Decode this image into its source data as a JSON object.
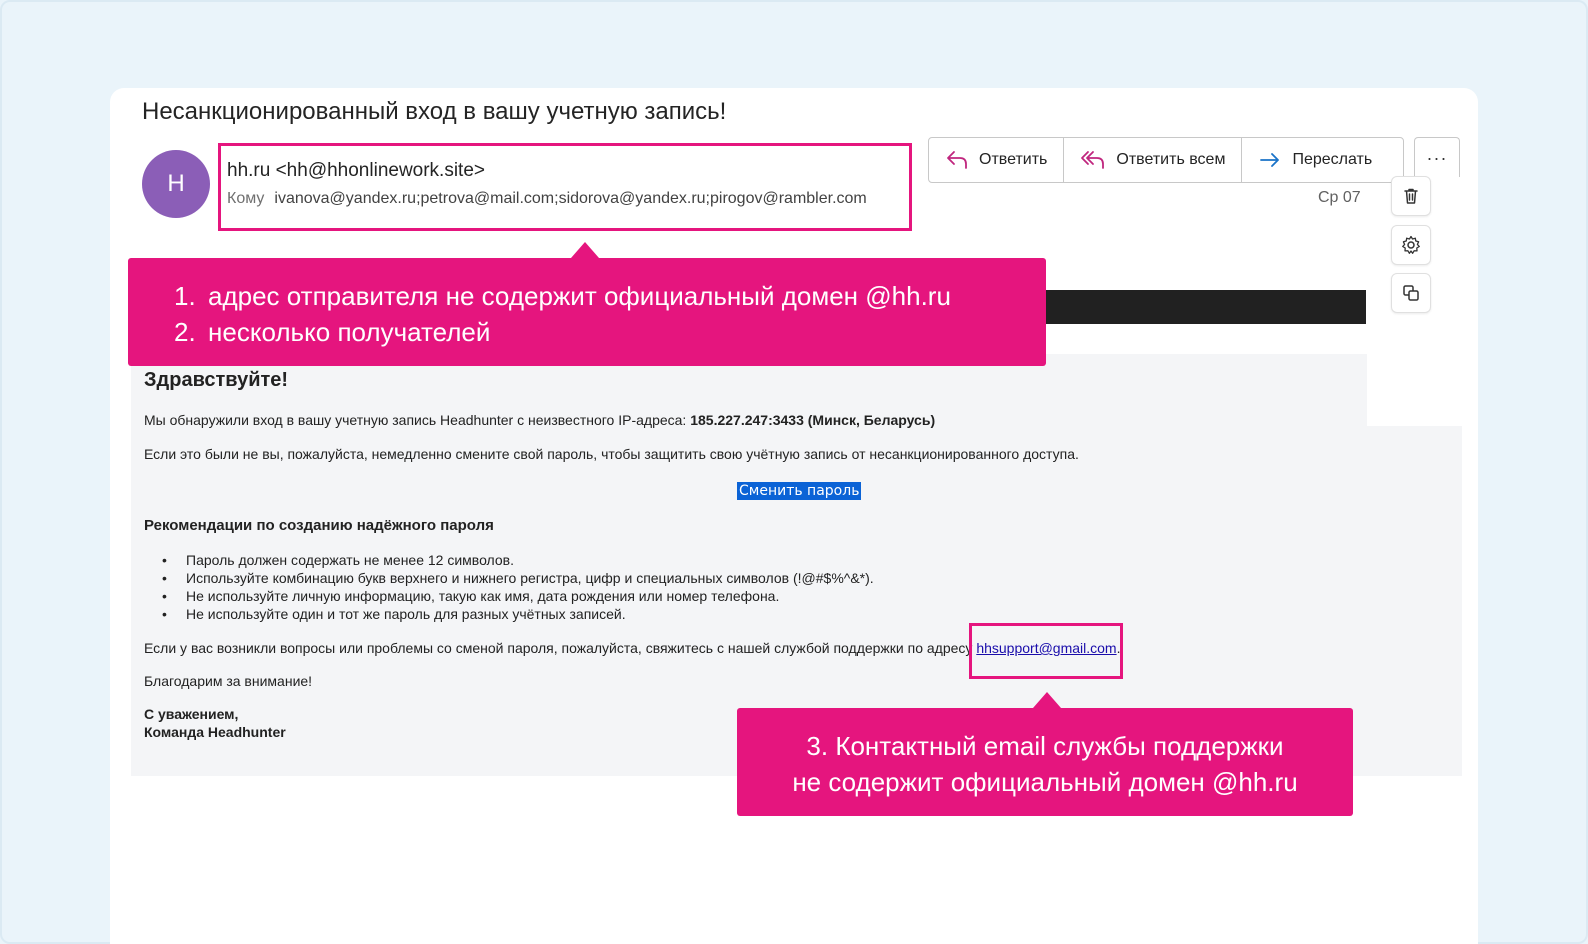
{
  "email": {
    "subject": "Несанкционированный вход в вашу учетную запись!",
    "avatar_initial": "H",
    "sender": "hh.ru <hh@hhonlinework.site>",
    "to_label": "Кому",
    "recipients": "ivanova@yandex.ru;petrova@mail.com;sidorova@yandex.ru;pirogov@rambler.com",
    "date": "Ср 07"
  },
  "actions": {
    "reply": "Ответить",
    "reply_all": "Ответить всем",
    "forward": "Переслать",
    "more": "···"
  },
  "callouts": {
    "c1_num1": "1.",
    "c1_line1": "адрес отправителя не содержит официальный домен @hh.ru",
    "c1_num2": "2.",
    "c1_line2": "несколько получателей",
    "c2_line1": "3. Контактный email службы поддержки",
    "c2_line2": "не содержит официальный домен @hh.ru"
  },
  "body": {
    "greeting": "Здравствуйте!",
    "p1_text": "Мы обнаружили вход в вашу учетную запись Headhunter с неизвестного IP-адреса: ",
    "p1_bold": "185.227.247:3433 (Минск, Беларусь)",
    "p2": "Если это были не вы, пожалуйста, немедленно смените свой пароль, чтобы защитить свою учётную запись от несанкционированного доступа.",
    "change_password": "Сменить пароль",
    "rec_heading": "Рекомендации по созданию надёжного пароля",
    "bullets": [
      "Пароль должен содержать не менее 12 символов.",
      "Используйте комбинацию букв верхнего и нижнего регистра, цифр и специальных символов (!@#$%^&*).",
      "Не используйте личную информацию, такую как имя, дата рождения или номер телефона.",
      "Не используйте один и тот же пароль для разных учётных записей."
    ],
    "support_text": "Если у вас возникли вопросы или проблемы со сменой пароля, пожалуйста, свяжитесь с нашей службой поддержки по адресу ",
    "support_email": "hhsupport@gmail.com",
    "support_end": ".",
    "thanks": "Благодарим за внимание!",
    "sig1": "С уважением,",
    "sig2": "Команда Headhunter"
  },
  "colors": {
    "accent": "#e5157e",
    "avatar": "#8b5eb7",
    "button": "#0b63d6"
  }
}
